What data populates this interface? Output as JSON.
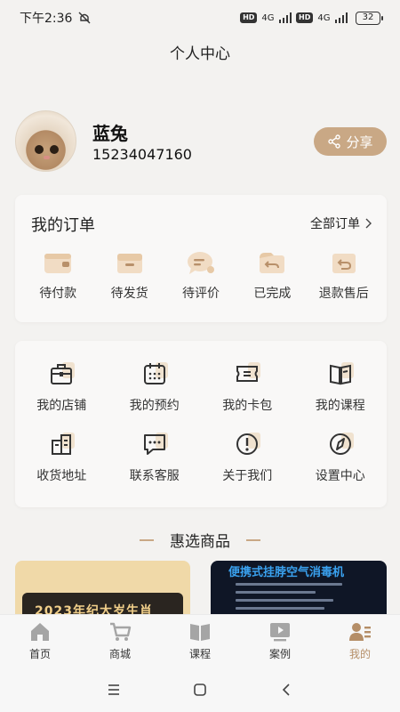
{
  "status_bar": {
    "time": "下午2:36",
    "net1": "4G",
    "net2": "4G",
    "battery": "32"
  },
  "header": {
    "title": "个人中心"
  },
  "profile": {
    "name": "蓝兔",
    "phone": "15234047160",
    "share_label": "分享"
  },
  "orders": {
    "title": "我的订单",
    "all_label": "全部订单",
    "items": [
      {
        "label": "待付款",
        "icon": "wallet-icon"
      },
      {
        "label": "待发货",
        "icon": "box-icon"
      },
      {
        "label": "待评价",
        "icon": "comment-icon"
      },
      {
        "label": "已完成",
        "icon": "return-folder-icon"
      },
      {
        "label": "退款售后",
        "icon": "refund-icon"
      }
    ]
  },
  "services": {
    "items": [
      {
        "label": "我的店铺",
        "icon": "store-icon"
      },
      {
        "label": "我的预约",
        "icon": "calendar-icon"
      },
      {
        "label": "我的卡包",
        "icon": "ticket-icon"
      },
      {
        "label": "我的课程",
        "icon": "book-icon"
      },
      {
        "label": "收货地址",
        "icon": "building-icon"
      },
      {
        "label": "联系客服",
        "icon": "chat-icon"
      },
      {
        "label": "关于我们",
        "icon": "info-icon"
      },
      {
        "label": "设置中心",
        "icon": "compass-icon"
      }
    ]
  },
  "featured": {
    "title": "惠选商品",
    "products": [
      {
        "banner_text": "2023年纪大岁生肖"
      },
      {
        "banner_text": "便携式挂脖空气消毒机"
      }
    ]
  },
  "tabbar": {
    "items": [
      {
        "label": "首页",
        "icon": "home-icon"
      },
      {
        "label": "商城",
        "icon": "cart-icon"
      },
      {
        "label": "课程",
        "icon": "book-open-icon"
      },
      {
        "label": "案例",
        "icon": "play-icon"
      },
      {
        "label": "我的",
        "icon": "profile-icon"
      }
    ],
    "active_color": "#b58e67"
  },
  "colors": {
    "accent": "#c9a885",
    "background": "#f3f2f0"
  }
}
